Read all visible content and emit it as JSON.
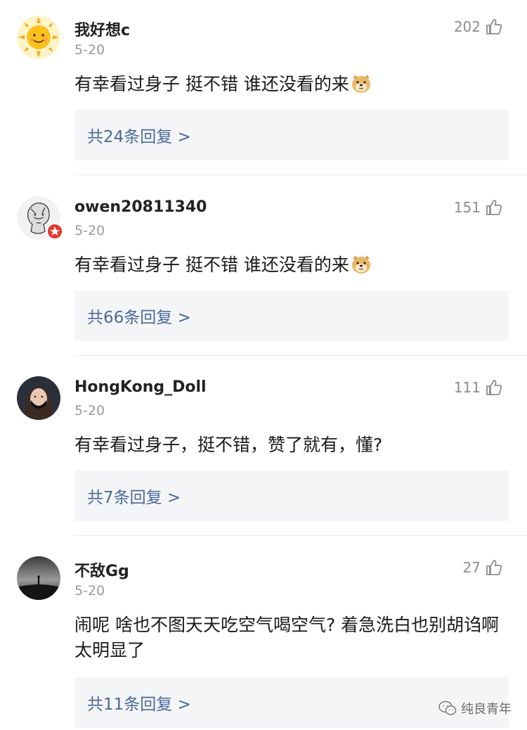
{
  "comments": [
    {
      "username": "我好想c",
      "date": "5-20",
      "likes": "202",
      "text": "有幸看过身子 挺不错 谁还没看的来",
      "emoji": "doge-emoji",
      "reply_link": "共24条回复 >",
      "avatar": "sun-avatar"
    },
    {
      "username": "owen20811340",
      "date": "5-20",
      "likes": "151",
      "text": "有幸看过身子 挺不错 谁还没看的来",
      "emoji": "doge-emoji",
      "reply_link": "共66条回复 >",
      "avatar": "sketch-avatar"
    },
    {
      "username": "HongKong_Doll",
      "date": "5-20",
      "likes": "111",
      "text": "有幸看过身子，挺不错，赞了就有，懂?",
      "reply_link": "共7条回复 >",
      "avatar": "portrait-avatar"
    },
    {
      "username": "不敌Gg",
      "date": "5-20",
      "likes": "27",
      "text": "闹呢 啥也不图天天吃空气喝空气? 着急洗白也别胡诌啊 太明显了",
      "reply_link": "共11条回复 >",
      "avatar": "landscape-avatar"
    }
  ],
  "watermark": "纯良青年",
  "colors": {
    "reply_link": "#4a6a9a",
    "reply_bg": "#f4f5f7",
    "date": "#9a9a9a",
    "like": "#8c8c8c"
  }
}
